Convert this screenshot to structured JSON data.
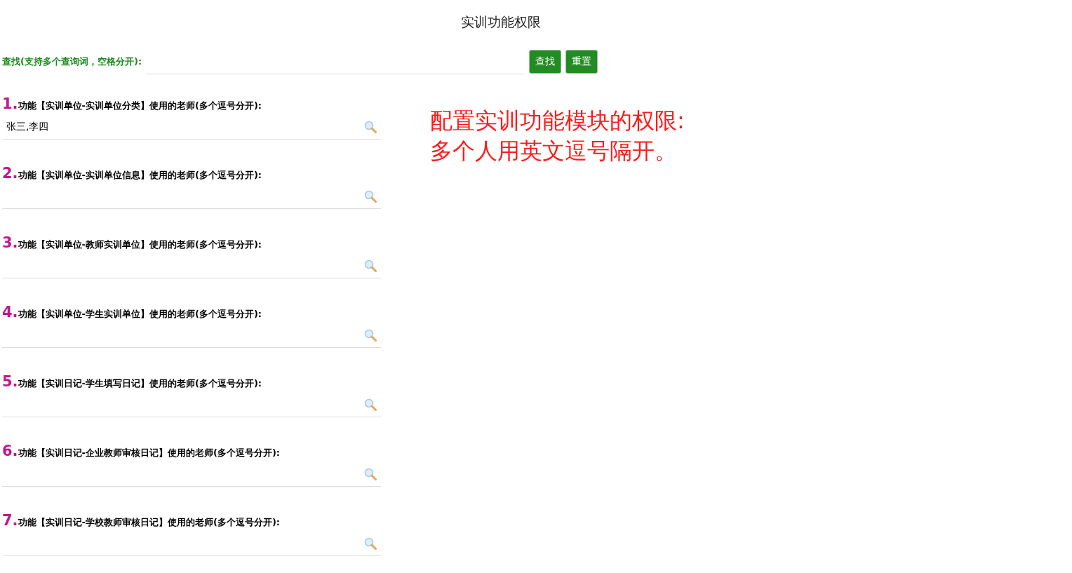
{
  "title": "实训功能权限",
  "search": {
    "label": "查找(支持多个查询词，空格分开):",
    "buttons": [
      "查找",
      "重置"
    ]
  },
  "functions": [
    {
      "number": "1.",
      "label": "功能【实训单位-实训单位分类】使用的老师(多个逗号分开):",
      "value": "张三,李四"
    },
    {
      "number": "2.",
      "label": "功能【实训单位-实训单位信息】使用的老师(多个逗号分开):"
    },
    {
      "number": "3.",
      "label": "功能【实训单位-教师实训单位】使用的老师(多个逗号分开):"
    },
    {
      "number": "4.",
      "label": "功能【实训单位-学生实训单位】使用的老师(多个逗号分开):"
    },
    {
      "number": "5.",
      "label": "功能【实训日记-学生填写日记】使用的老师(多个逗号分开):"
    },
    {
      "number": "6.",
      "label": "功能【实训日记-企业教师审核日记】使用的老师(多个逗号分开):"
    },
    {
      "number": "7.",
      "label": "功能【实训日记-学校教师审核日记】使用的老师(多个逗号分开):"
    }
  ],
  "note": [
    "配置实训功能模块的权限:",
    "多个人用英文逗号隔开。"
  ]
}
